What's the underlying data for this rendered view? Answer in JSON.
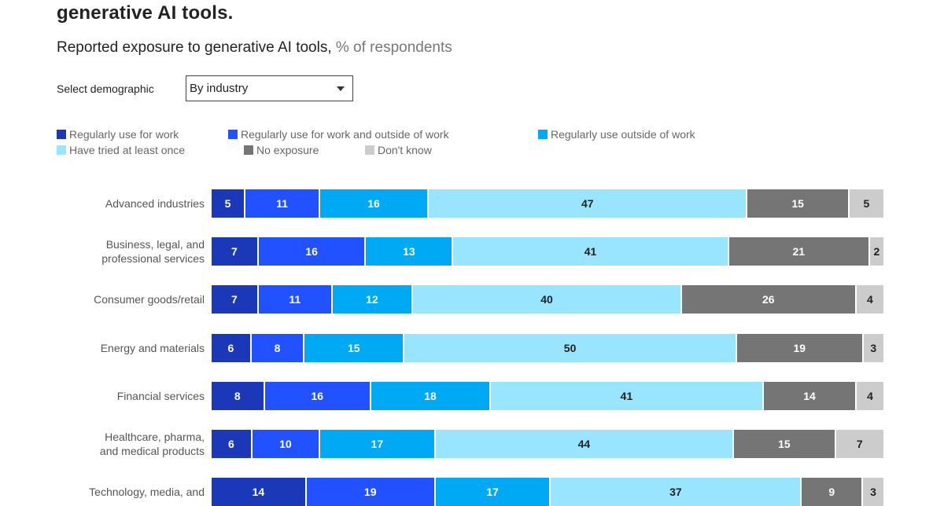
{
  "header": {
    "title": "generative AI tools.",
    "subtitle_main": "Reported exposure to generative AI tools,",
    "subtitle_unit": " % of respondents"
  },
  "controls": {
    "select_label": "Select demographic",
    "select_value": "By industry"
  },
  "chart_data": {
    "type": "bar",
    "orientation": "horizontal",
    "stacked": true,
    "title": "Reported exposure to generative AI tools",
    "xlabel": "% of respondents",
    "ylabel": "",
    "xlim": [
      0,
      100
    ],
    "grid": false,
    "legend_position": "top-left",
    "categories": [
      [
        "Advanced industries"
      ],
      [
        "Business, legal, and",
        "professional services"
      ],
      [
        "Consumer goods/retail"
      ],
      [
        "Energy and materials"
      ],
      [
        "Financial services"
      ],
      [
        "Healthcare, pharma,",
        "and medical products"
      ],
      [
        "Technology, media, and"
      ]
    ],
    "series": [
      {
        "name": "Regularly use for work",
        "color": "#1b38b8",
        "text_color": "#ffffff",
        "values": [
          5,
          7,
          7,
          6,
          8,
          6,
          14
        ]
      },
      {
        "name": "Regularly use for work and outside of work",
        "color": "#2251ff",
        "text_color": "#ffffff",
        "values": [
          11,
          16,
          11,
          8,
          16,
          10,
          19
        ]
      },
      {
        "name": "Regularly use outside of work",
        "color": "#00a9f4",
        "text_color": "#ffffff",
        "values": [
          16,
          13,
          12,
          15,
          18,
          17,
          17
        ]
      },
      {
        "name": "Have tried at least once",
        "color": "#99e4ff",
        "text_color": "#222222",
        "values": [
          47,
          41,
          40,
          50,
          41,
          44,
          37
        ]
      },
      {
        "name": "No exposure",
        "color": "#757575",
        "text_color": "#ffffff",
        "values": [
          15,
          21,
          26,
          19,
          14,
          15,
          9
        ]
      },
      {
        "name": "Don't know",
        "color": "#cccccc",
        "text_color": "#222222",
        "values": [
          5,
          2,
          4,
          3,
          4,
          7,
          3
        ]
      }
    ]
  }
}
